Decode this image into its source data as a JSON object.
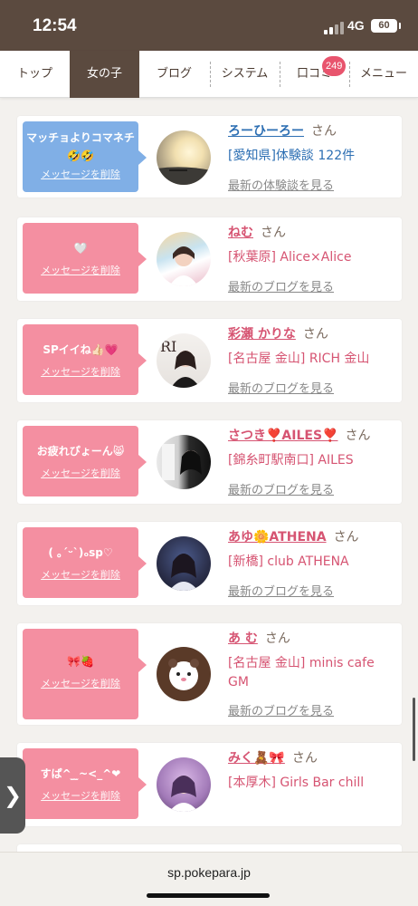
{
  "status_bar": {
    "time": "12:54",
    "network": "4G",
    "battery": "60"
  },
  "nav": {
    "tabs": [
      {
        "label": "トップ",
        "active": false
      },
      {
        "label": "女の子",
        "active": true
      },
      {
        "label": "ブログ",
        "active": false
      },
      {
        "label": "システム",
        "active": false
      },
      {
        "label": "口コミ",
        "active": false
      },
      {
        "label": "メニュー",
        "active": false
      }
    ],
    "reviews_badge": "249"
  },
  "messages": [
    {
      "bubble_color": "blue",
      "message": "マッチョよりコマネチ🤣🤣",
      "delete_label": "メッセージを削除",
      "name": "ろーひーろー",
      "honorific": "さん",
      "shop": "[愛知県]体験談 122件",
      "link": "最新の体験談を見る"
    },
    {
      "bubble_color": "pink",
      "message": "🤍",
      "delete_label": "メッセージを削除",
      "name": "ねむ",
      "honorific": "さん",
      "shop": "[秋葉原] Alice×Alice",
      "link": "最新のブログを見る"
    },
    {
      "bubble_color": "pink",
      "message": "SPイイね👍🏻💗",
      "delete_label": "メッセージを削除",
      "name": "彩瀬 かりな",
      "honorific": "さん",
      "shop": "[名古屋 金山] RICH 金山",
      "link": "最新のブログを見る"
    },
    {
      "bubble_color": "pink",
      "message": "お疲れぴょーん😸",
      "delete_label": "メッセージを削除",
      "name": "さつき❣️AILES❣️",
      "honorific": "さん",
      "shop": "[錦糸町駅南口] AILES",
      "link": "最新のブログを見る"
    },
    {
      "bubble_color": "pink",
      "message": "( ｡ˊᵕˋ)ₒsp♡",
      "delete_label": "メッセージを削除",
      "name": "あゆ🌼ATHENA",
      "honorific": "さん",
      "shop": "[新橋] club ATHENA",
      "link": "最新のブログを見る"
    },
    {
      "bubble_color": "pink",
      "message": "🎀🍓",
      "delete_label": "メッセージを削除",
      "name": "あ む",
      "honorific": "さん",
      "shop": "[名古屋 金山] minis cafe GM",
      "link": "最新のブログを見る"
    },
    {
      "bubble_color": "pink",
      "message": "すぱ^ ̫ ̫~<_^❤",
      "delete_label": "メッセージを削除",
      "name": "みく🧸🎀",
      "honorific": "さん",
      "shop": "[本厚木] Girls Bar chill",
      "link": ""
    }
  ],
  "side_handle": "❯",
  "url": "sp.pokepara.jp"
}
